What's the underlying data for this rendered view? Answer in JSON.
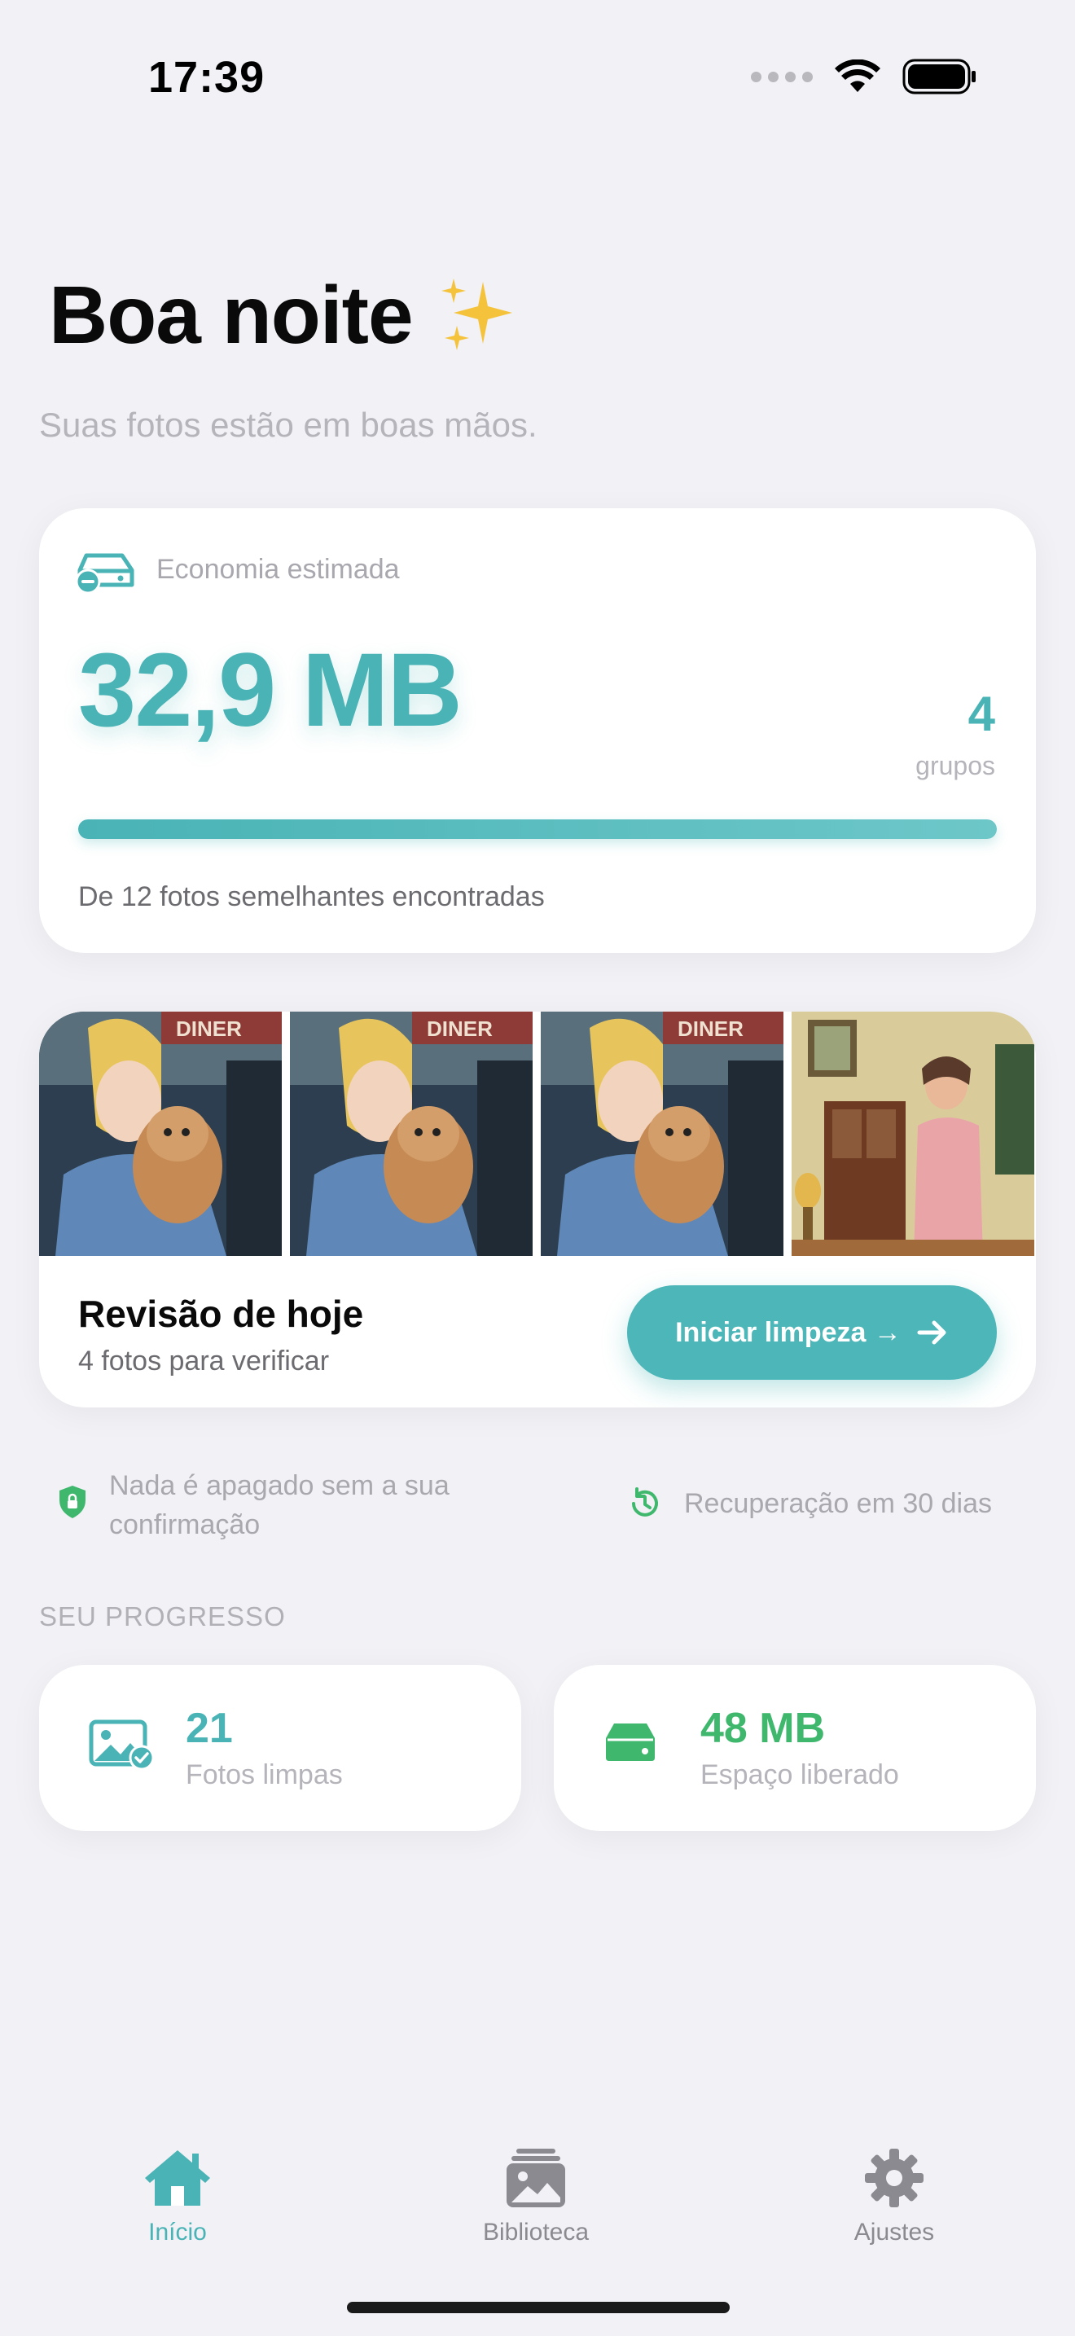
{
  "status_bar": {
    "time": "17:39"
  },
  "header": {
    "greeting": "Boa noite",
    "greeting_emoji": "✨",
    "subtitle": "Suas fotos estão em boas mãos."
  },
  "savings": {
    "label": "Economia estimada",
    "amount": "32,9 MB",
    "groups_count": "4",
    "groups_label": "grupos",
    "progress": 1.0,
    "caption": "De 12 fotos semelhantes encontradas",
    "icon": "drive-minus-icon"
  },
  "review": {
    "title": "Revisão de hoje",
    "subtitle": "4 fotos para verificar",
    "button_label": "Iniciar limpeza →",
    "photos": [
      {
        "description": "girl-with-puppy"
      },
      {
        "description": "girl-with-puppy"
      },
      {
        "description": "girl-with-puppy"
      },
      {
        "description": "man-in-living-room"
      }
    ],
    "photo_sign_text": "DINER"
  },
  "info": {
    "safety_text": "Nada é apagado sem a sua confirmação",
    "recovery_text": "Recuperação em 30 dias"
  },
  "progress_section": {
    "title": "SEU PROGRESSO",
    "stats": [
      {
        "value": "21",
        "label": "Fotos limpas",
        "color": "#49b3b5",
        "icon": "photo-check-icon"
      },
      {
        "value": "48 MB",
        "label": "Espaço liberado",
        "color": "#3fb86e",
        "icon": "drive-icon"
      }
    ]
  },
  "tab_bar": {
    "tabs": [
      {
        "label": "Início",
        "icon": "home-icon",
        "active": true
      },
      {
        "label": "Biblioteca",
        "icon": "photo-library-icon",
        "active": false
      },
      {
        "label": "Ajustes",
        "icon": "gear-icon",
        "active": false
      }
    ]
  },
  "colors": {
    "accent": "#49b3b5",
    "green": "#3fb86e",
    "background": "#f1f1f6"
  }
}
